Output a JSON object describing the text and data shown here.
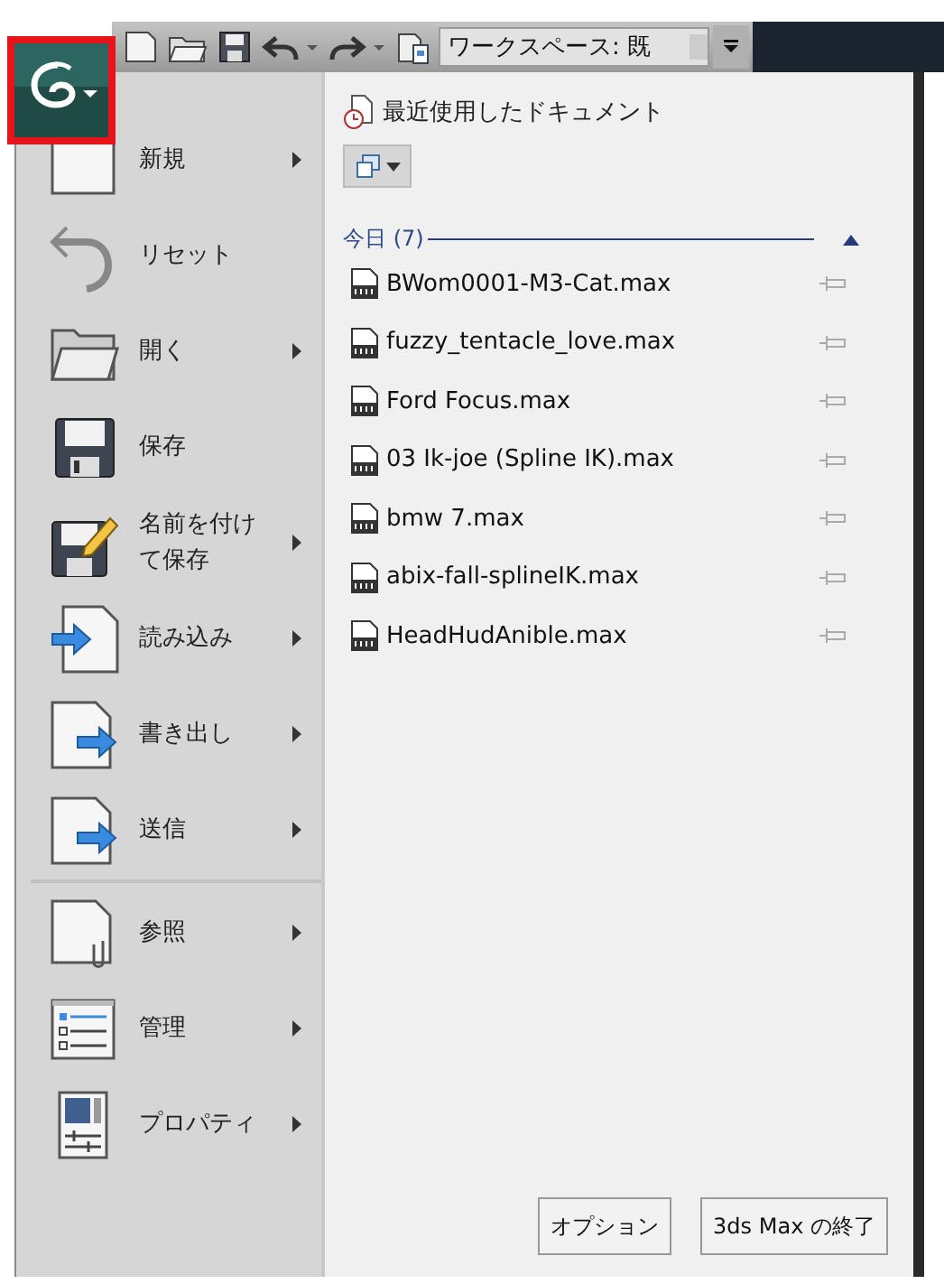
{
  "toolbar": {
    "workspace": "ワークスペース: 既"
  },
  "app_menu": {
    "command_groups": [
      [
        {
          "label": "新規",
          "submenu": true
        },
        {
          "label": "リセット",
          "submenu": false
        },
        {
          "label": "開く",
          "submenu": true
        },
        {
          "label": "保存",
          "submenu": false
        },
        {
          "label": "名前を付けて保存",
          "submenu": true
        },
        {
          "label": "読み込み",
          "submenu": true
        },
        {
          "label": "書き出し",
          "submenu": true
        },
        {
          "label": "送信",
          "submenu": true
        }
      ],
      [
        {
          "label": "参照",
          "submenu": true
        },
        {
          "label": "管理",
          "submenu": true
        },
        {
          "label": "プロパティ",
          "submenu": true
        }
      ]
    ],
    "recent": {
      "title": "最近使用したドキュメント",
      "section": {
        "label": "今日 (7)",
        "expanded": true,
        "files": [
          {
            "name": "BWom0001-M3-Cat.max",
            "pinned": false
          },
          {
            "name": "fuzzy_tentacle_love.max",
            "pinned": false
          },
          {
            "name": "Ford Focus.max",
            "pinned": false
          },
          {
            "name": "03 Ik-joe (Spline IK).max",
            "pinned": false
          },
          {
            "name": "bmw 7.max",
            "pinned": false
          },
          {
            "name": "abix-fall-splineIK.max",
            "pinned": false
          },
          {
            "name": "HeadHudAnible.max",
            "pinned": false
          }
        ]
      }
    },
    "buttons": [
      "オプション",
      "3ds Max の終了"
    ]
  }
}
